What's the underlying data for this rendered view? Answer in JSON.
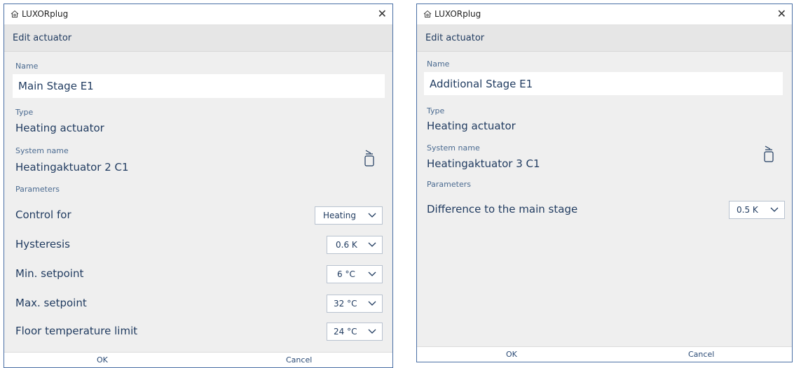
{
  "left": {
    "app_title": "LUXORplug",
    "header": "Edit actuator",
    "name_label": "Name",
    "name_value": "Main Stage E1",
    "type_label": "Type",
    "type_value": "Heating actuator",
    "system_name_label": "System name",
    "system_name_value": "Heatingaktuator 2 C1",
    "parameters_label": "Parameters",
    "params": [
      {
        "label": "Control for",
        "value": "Heating"
      },
      {
        "label": "Hysteresis",
        "value": "0.6 K"
      },
      {
        "label": "Min. setpoint",
        "value": "6 °C"
      },
      {
        "label": "Max. setpoint",
        "value": "32 °C"
      },
      {
        "label": "Floor temperature limit",
        "value": "24 °C"
      }
    ],
    "ok_label": "OK",
    "cancel_label": "Cancel"
  },
  "right": {
    "app_title": "LUXORplug",
    "header": "Edit actuator",
    "name_label": "Name",
    "name_value": "Additional Stage E1",
    "type_label": "Type",
    "type_value": "Heating actuator",
    "system_name_label": "System name",
    "system_name_value": "Heatingaktuator 3 C1",
    "parameters_label": "Parameters",
    "params": [
      {
        "label": "Difference to the main stage",
        "value": "0.5 K"
      }
    ],
    "ok_label": "OK",
    "cancel_label": "Cancel"
  }
}
